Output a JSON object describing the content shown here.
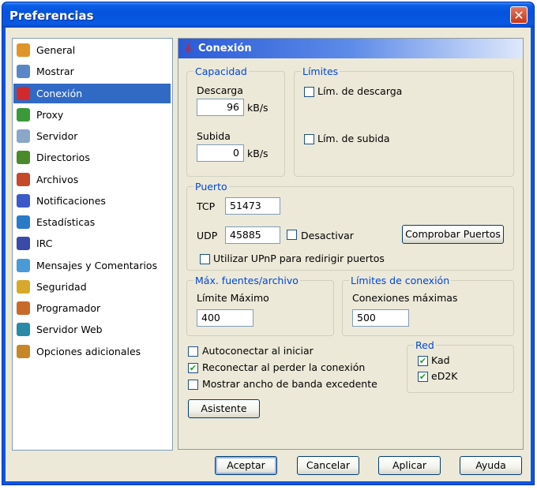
{
  "window": {
    "title": "Preferencias",
    "close_glyph": "✕"
  },
  "sidebar": {
    "items": [
      {
        "label": "General",
        "icon": "gear-icon",
        "color": "#e0952a"
      },
      {
        "label": "Mostrar",
        "icon": "monitor-icon",
        "color": "#5a86c8"
      },
      {
        "label": "Conexión",
        "icon": "plug-icon",
        "color": "#d22a2a",
        "selected": true
      },
      {
        "label": "Proxy",
        "icon": "proxy-icon",
        "color": "#3a9a3a"
      },
      {
        "label": "Servidor",
        "icon": "server-icon",
        "color": "#8aa6c8"
      },
      {
        "label": "Directorios",
        "icon": "folder-icon",
        "color": "#4a8a2a"
      },
      {
        "label": "Archivos",
        "icon": "files-icon",
        "color": "#c44a2a"
      },
      {
        "label": "Notificaciones",
        "icon": "notification-icon",
        "color": "#3a5ac8"
      },
      {
        "label": "Estadísticas",
        "icon": "stats-icon",
        "color": "#2a7ac8"
      },
      {
        "label": "IRC",
        "icon": "irc-icon",
        "color": "#3a4aa8"
      },
      {
        "label": "Mensajes y Comentarios",
        "icon": "message-icon",
        "color": "#4a9ad8"
      },
      {
        "label": "Seguridad",
        "icon": "lock-icon",
        "color": "#d8a82a"
      },
      {
        "label": "Programador",
        "icon": "calendar-icon",
        "color": "#c86a2a"
      },
      {
        "label": "Servidor Web",
        "icon": "globe-icon",
        "color": "#2a8aa8"
      },
      {
        "label": "Opciones adicionales",
        "icon": "options-icon",
        "color": "#c8862a"
      }
    ]
  },
  "panel": {
    "title": "Conexión",
    "capacidad": {
      "legend": "Capacidad",
      "descarga_label": "Descarga",
      "descarga_value": "96",
      "descarga_unit": "kB/s",
      "subida_label": "Subida",
      "subida_value": "0",
      "subida_unit": "kB/s"
    },
    "limites": {
      "legend": "Límites",
      "descarga": "Lím. de descarga",
      "subida": "Lím. de subida"
    },
    "puerto": {
      "legend": "Puerto",
      "tcp_label": "TCP",
      "tcp_value": "51473",
      "udp_label": "UDP",
      "udp_value": "45885",
      "desactivar": "Desactivar",
      "comprobar": "Comprobar Puertos",
      "upnp": "Utilizar UPnP para redirigir puertos"
    },
    "fuentes": {
      "legend": "Máx. fuentes/archivo",
      "label": "Límite Máximo",
      "value": "400"
    },
    "conexion": {
      "legend": "Límites de conexión",
      "label": "Conexiones máximas",
      "value": "500"
    },
    "options": {
      "autoconectar": "Autoconectar al iniciar",
      "reconectar": "Reconectar al perder la conexión",
      "mostrar": "Mostrar ancho de banda excedente"
    },
    "red": {
      "legend": "Red",
      "kad": "Kad",
      "ed2k": "eD2K"
    },
    "asistente": "Asistente",
    "check_glyph": "✔"
  },
  "footer": {
    "aceptar": "Aceptar",
    "cancelar": "Cancelar",
    "aplicar": "Aplicar",
    "ayuda": "Ayuda"
  }
}
